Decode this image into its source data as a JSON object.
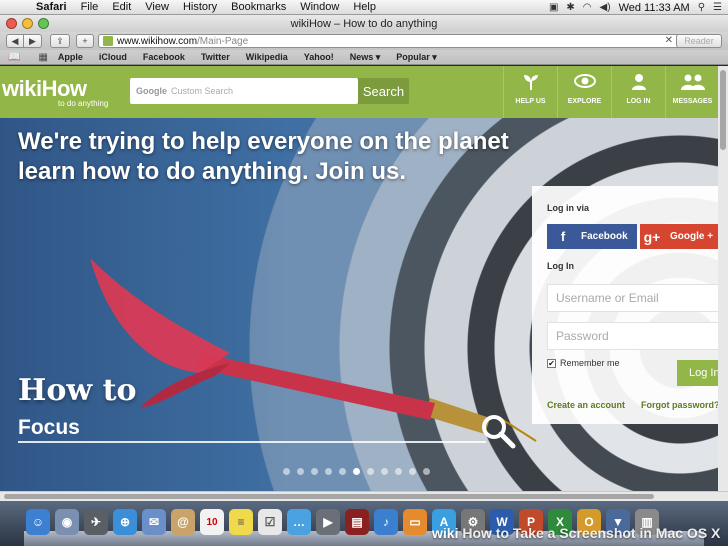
{
  "menubar": {
    "app": "Safari",
    "menus": [
      "File",
      "Edit",
      "View",
      "History",
      "Bookmarks",
      "Window",
      "Help"
    ],
    "clock": "Wed 11:33 AM"
  },
  "window": {
    "title": "wikiHow – How to do anything"
  },
  "toolbar": {
    "url_host": "www.wikihow.com",
    "url_path": "/Main-Page",
    "reader_label": "Reader"
  },
  "bookmarks": [
    "Apple",
    "iCloud",
    "Facebook",
    "Twitter",
    "Wikipedia",
    "Yahoo!",
    "News ▾",
    "Popular ▾"
  ],
  "header": {
    "logo_wiki": "wiki",
    "logo_how": "How",
    "tagline": "to do anything",
    "search_placeholder": "Custom Search",
    "search_google_label": "Google",
    "search_button": "Search",
    "nav": [
      {
        "label": "HELP US",
        "icon": "sprout-icon"
      },
      {
        "label": "EXPLORE",
        "icon": "eye-icon"
      },
      {
        "label": "LOG IN",
        "icon": "user-icon"
      },
      {
        "label": "MESSAGES",
        "icon": "people-icon"
      }
    ]
  },
  "hero": {
    "headline": "We're trying to help everyone on the planet learn how to do anything. Join us.",
    "how_to": "How to",
    "topic": "Focus",
    "slide_count": 11,
    "active_slide": 5
  },
  "login": {
    "via_label": "Log in via",
    "facebook_label": "Facebook",
    "google_label": "Google +",
    "login_label": "Log In",
    "username_placeholder": "Username or Email",
    "password_placeholder": "Password",
    "remember_label": "Remember me",
    "login_button": "Log In",
    "create_account": "Create an account",
    "forgot_password": "Forgot password?"
  },
  "dock": {
    "calendar_day": "10"
  },
  "watermark": {
    "brand": "wiki",
    "text": "How to Take a Screenshot in Mac OS X"
  },
  "colors": {
    "brand_green": "#93b648",
    "facebook": "#3b5998",
    "google": "#d6452f"
  }
}
